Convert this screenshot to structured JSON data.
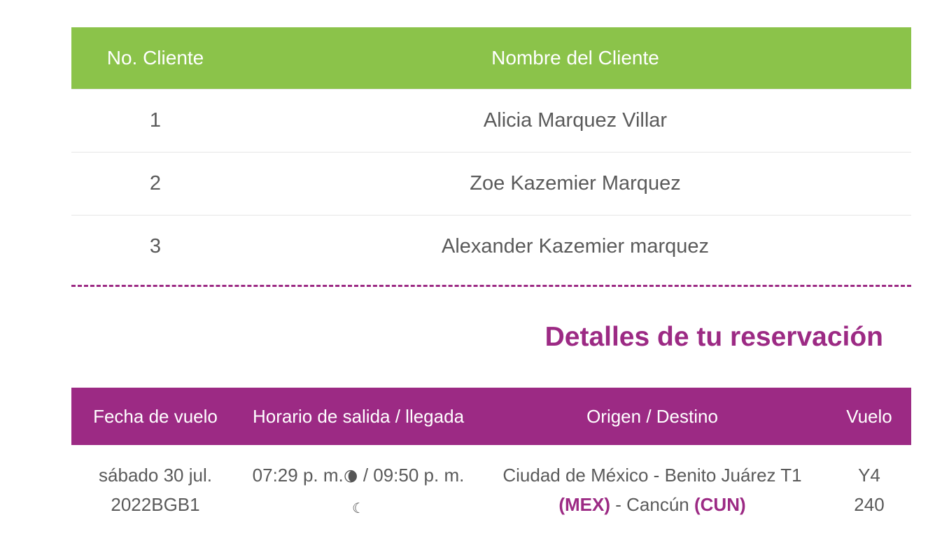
{
  "clients_table": {
    "headers": {
      "number": "No. Cliente",
      "name": "Nombre del Cliente"
    },
    "rows": [
      {
        "number": "1",
        "name": "Alicia  Marquez Villar"
      },
      {
        "number": "2",
        "name": "Zoe  Kazemier Marquez"
      },
      {
        "number": "3",
        "name": "Alexander  Kazemier marquez"
      }
    ]
  },
  "reservation": {
    "title": "Detalles de tu reservación",
    "headers": {
      "date": "Fecha de vuelo",
      "schedule": "Horario de salida / llegada",
      "route": "Origen / Destino",
      "flight": "Vuelo"
    },
    "flight": {
      "date_line1": "sábado 30 jul.",
      "date_line2": "2022BGB1",
      "departure": "07:29 p. m.",
      "separator": " / ",
      "arrival": "09:50 p. m.",
      "origin_text": "Ciudad de México - Benito Juárez T1 ",
      "origin_code": "(MEX)",
      "route_sep": " - ",
      "destination_text": "Cancún ",
      "destination_code": "(CUN)",
      "flight_line1": "Y4",
      "flight_line2": "240"
    }
  },
  "colors": {
    "green": "#8bc34a",
    "purple": "#9c2a84"
  },
  "icons": {
    "departure": "moon-sunset-icon",
    "arrival": "moon-icon"
  }
}
